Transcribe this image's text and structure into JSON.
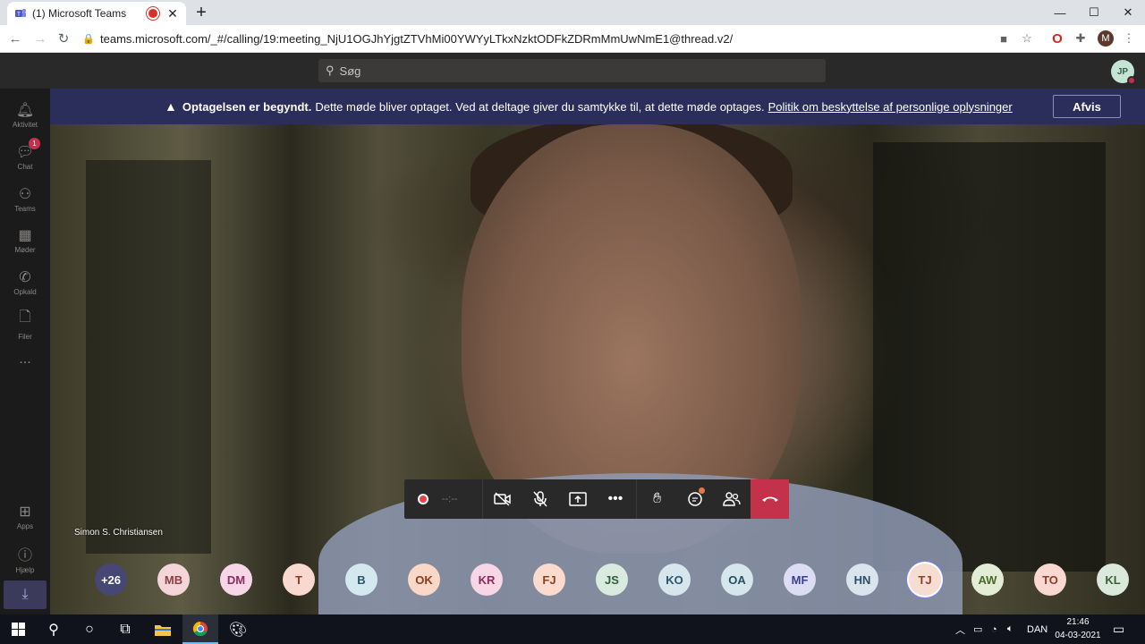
{
  "browser": {
    "tab_title": "(1) Microsoft Teams",
    "tab_close": "✕",
    "new_tab": "+",
    "url": "teams.microsoft.com/_#/calling/19:meeting_NjU1OGJhYjgtZTVhMi00YWYyLTkxNzktODFkZDRmMmUwNmE1@thread.v2/",
    "profile_initial": "M",
    "window_controls": [
      "—",
      "☐",
      "✕"
    ]
  },
  "teams": {
    "search_placeholder": "Søg",
    "user_initials": "JP",
    "rail": [
      {
        "label": "Aktivitet",
        "icon": "bell-icon"
      },
      {
        "label": "Chat",
        "icon": "chat-icon",
        "badge": "1"
      },
      {
        "label": "Teams",
        "icon": "teams-icon"
      },
      {
        "label": "Møder",
        "icon": "calendar-icon"
      },
      {
        "label": "Opkald",
        "icon": "phone-icon"
      },
      {
        "label": "Filer",
        "icon": "file-icon"
      },
      {
        "label": "...",
        "icon": "more-icon"
      },
      {
        "label": "Apps",
        "icon": "apps-icon"
      },
      {
        "label": "Hjælp",
        "icon": "help-icon"
      }
    ]
  },
  "banner": {
    "bold": "Optagelsen er begyndt.",
    "text": "Dette møde bliver optaget. Ved at deltage giver du samtykke til, at dette møde optages.",
    "link": "Politik om beskyttelse af personlige oplysninger",
    "button": "Afvis"
  },
  "call": {
    "timer": "--:--",
    "speaker_name": "Simon S. Christiansen"
  },
  "participants": [
    {
      "initials": "+26",
      "bg": "#464775",
      "fg": "#ffffff"
    },
    {
      "initials": "MB",
      "bg": "#f4d6d9",
      "fg": "#8f3a47"
    },
    {
      "initials": "DM",
      "bg": "#f7d6e8",
      "fg": "#8a2f5e"
    },
    {
      "initials": "T",
      "bg": "#f9d9cf",
      "fg": "#8e3d27"
    },
    {
      "initials": "B",
      "bg": "#d4e8f0",
      "fg": "#28566b"
    },
    {
      "initials": "OK",
      "bg": "#fad7c7",
      "fg": "#8d3b1c"
    },
    {
      "initials": "KR",
      "bg": "#f7d6e6",
      "fg": "#8a2d5a"
    },
    {
      "initials": "FJ",
      "bg": "#fbdbcd",
      "fg": "#8e4024"
    },
    {
      "initials": "JS",
      "bg": "#d9ebdf",
      "fg": "#2e5d3c"
    },
    {
      "initials": "KO",
      "bg": "#d7e6ee",
      "fg": "#2b5468"
    },
    {
      "initials": "OA",
      "bg": "#d5e6ec",
      "fg": "#284f60"
    },
    {
      "initials": "MF",
      "bg": "#dcdcf5",
      "fg": "#3c3f8c"
    },
    {
      "initials": "HN",
      "bg": "#d9e4ec",
      "fg": "#2e4e66"
    },
    {
      "initials": "TJ",
      "bg": "#f6ddd2",
      "fg": "#8a4329",
      "ring": true
    },
    {
      "initials": "AW",
      "bg": "#e2ecd6",
      "fg": "#4a6a25"
    },
    {
      "initials": "TO",
      "bg": "#fad8d2",
      "fg": "#903a2c"
    },
    {
      "initials": "KL",
      "bg": "#dbe9dc",
      "fg": "#3a613e"
    }
  ],
  "taskbar": {
    "language": "DAN",
    "time": "21:46",
    "date": "04-03-2021"
  }
}
